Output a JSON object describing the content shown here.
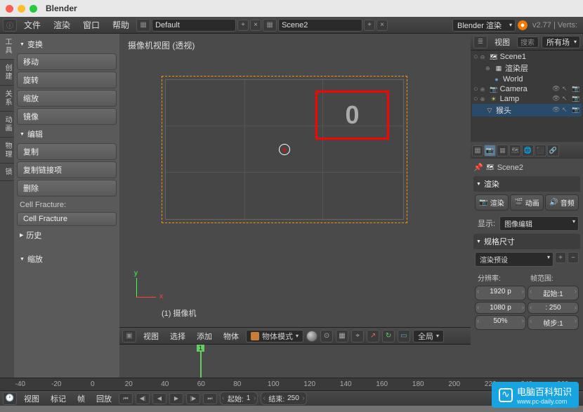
{
  "title": "Blender",
  "menubar": {
    "items": [
      "文件",
      "渲染",
      "窗口",
      "帮助"
    ],
    "layout": "Default",
    "scene": "Scene2",
    "engine": "Blender 渲染",
    "version": "v2.77 | Verts:"
  },
  "toolshelf": {
    "tabs": [
      "工具",
      "创建",
      "关系",
      "动画",
      "物理",
      "锁"
    ],
    "transform_header": "变换",
    "transform": [
      "移动",
      "旋转",
      "缩放"
    ],
    "mirror": "镜像",
    "edit_header": "编辑",
    "edit": [
      "复制",
      "复制链接项",
      "删除"
    ],
    "cell_label": "Cell Fracture:",
    "cell_btn": "Cell Fracture",
    "history_header": "历史",
    "scale_header": "缩放"
  },
  "viewport": {
    "title": "摄像机视图 (透视)",
    "hotkey": "0",
    "camera_label": "(1) 摄像机",
    "header_menus": [
      "视图",
      "选择",
      "添加",
      "物体"
    ],
    "mode": "物体模式",
    "orientation": "全局"
  },
  "timeline": {
    "playhead": 1,
    "ruler": [
      "-40",
      "-20",
      "0",
      "20",
      "40",
      "60",
      "80",
      "100",
      "120",
      "140",
      "160",
      "180",
      "200",
      "220",
      "240",
      "260"
    ],
    "menus": [
      "视图",
      "标记",
      "帧",
      "回放"
    ],
    "start_label": "起始:",
    "start": 1,
    "end_label": "结束:",
    "end": 250
  },
  "outliner": {
    "view_btn": "视图",
    "search_placeholder": "搜索",
    "filter_btn": "所有场",
    "tree": [
      {
        "indent": 0,
        "expand": "⊕",
        "icon": "scene",
        "label": "Scene1"
      },
      {
        "indent": 1,
        "expand": "⊕",
        "icon": "layers",
        "label": "渲染层"
      },
      {
        "indent": 1,
        "expand": "",
        "icon": "world",
        "label": "World"
      },
      {
        "indent": 1,
        "expand": "⊕",
        "icon": "camera",
        "label": "Camera",
        "vis": true
      },
      {
        "indent": 1,
        "expand": "⊕",
        "icon": "lamp",
        "label": "Lamp",
        "vis": true
      },
      {
        "indent": 1,
        "expand": "",
        "icon": "obj",
        "label": "猴头",
        "vis": true
      }
    ]
  },
  "properties": {
    "breadcrumb": "Scene2",
    "render_header": "渲染",
    "render_btn": "渲染",
    "anim_btn": "动画",
    "audio_btn": "音频",
    "display_label": "显示:",
    "display_value": "图像编辑",
    "dimensions_header": "规格尺寸",
    "preset": "渲染预设",
    "res_label": "分辨率:",
    "res_x": "1920 p",
    "res_y": "1080 p",
    "res_pct": "50%",
    "frame_label": "帧范围:",
    "frame_start_label": "起始:1",
    "frame_end": ": 250",
    "frame_step_label": "帧步:1"
  },
  "watermark": {
    "title": "电脑百科知识",
    "url": "www.pc-daily.com"
  }
}
